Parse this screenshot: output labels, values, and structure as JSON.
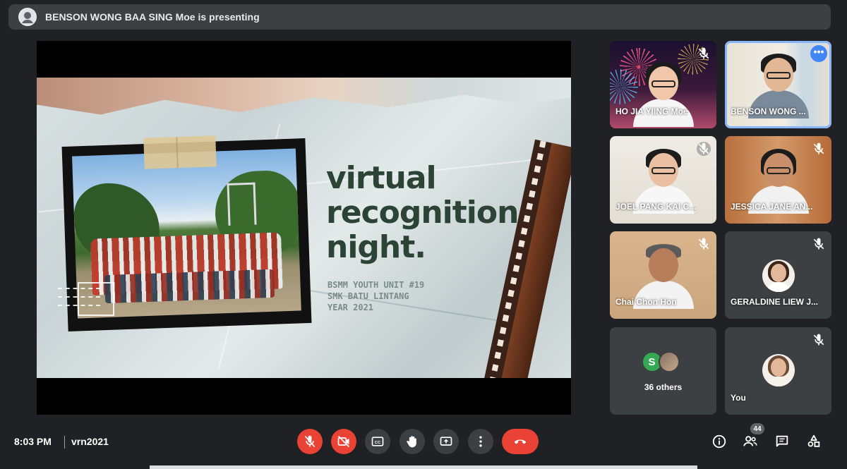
{
  "presenting_bar": {
    "text": "BENSON WONG BAA SING Moe is presenting"
  },
  "slide": {
    "title_lines": [
      "virtual",
      "recognition",
      "night."
    ],
    "subtitle_lines": [
      "BSMM YOUTH UNIT #19",
      "SMK BATU LINTANG",
      "YEAR 2021"
    ]
  },
  "participants": [
    {
      "name": "HO JIA YIING Moe",
      "muted": true
    },
    {
      "name": "BENSON WONG ...",
      "muted": false,
      "more": "•••"
    },
    {
      "name": "JOEL PANG KAI C...",
      "muted": true
    },
    {
      "name": "JESSICA JANE AN...",
      "muted": true
    },
    {
      "name": "Chai Chon Hon",
      "muted": true
    },
    {
      "name": "GERALDINE LIEW J...",
      "muted": true
    },
    {
      "name": "36 others",
      "badge_letter": "S"
    },
    {
      "name": "You",
      "muted": true
    }
  ],
  "bottom_bar": {
    "time": "8:03 PM",
    "meeting_code": "vrn2021",
    "participant_count": "44"
  },
  "colors": {
    "background": "#202124",
    "tile": "#3c4043",
    "red": "#ea4335",
    "accent_blue": "#8ab4f8",
    "green": "#34a853"
  },
  "icons": [
    "presenter-icon",
    "mic-off-icon",
    "camera-off-icon",
    "captions-icon",
    "raise-hand-icon",
    "present-screen-icon",
    "more-options-icon",
    "hang-up-icon",
    "info-icon",
    "people-icon",
    "chat-icon",
    "activities-icon"
  ]
}
